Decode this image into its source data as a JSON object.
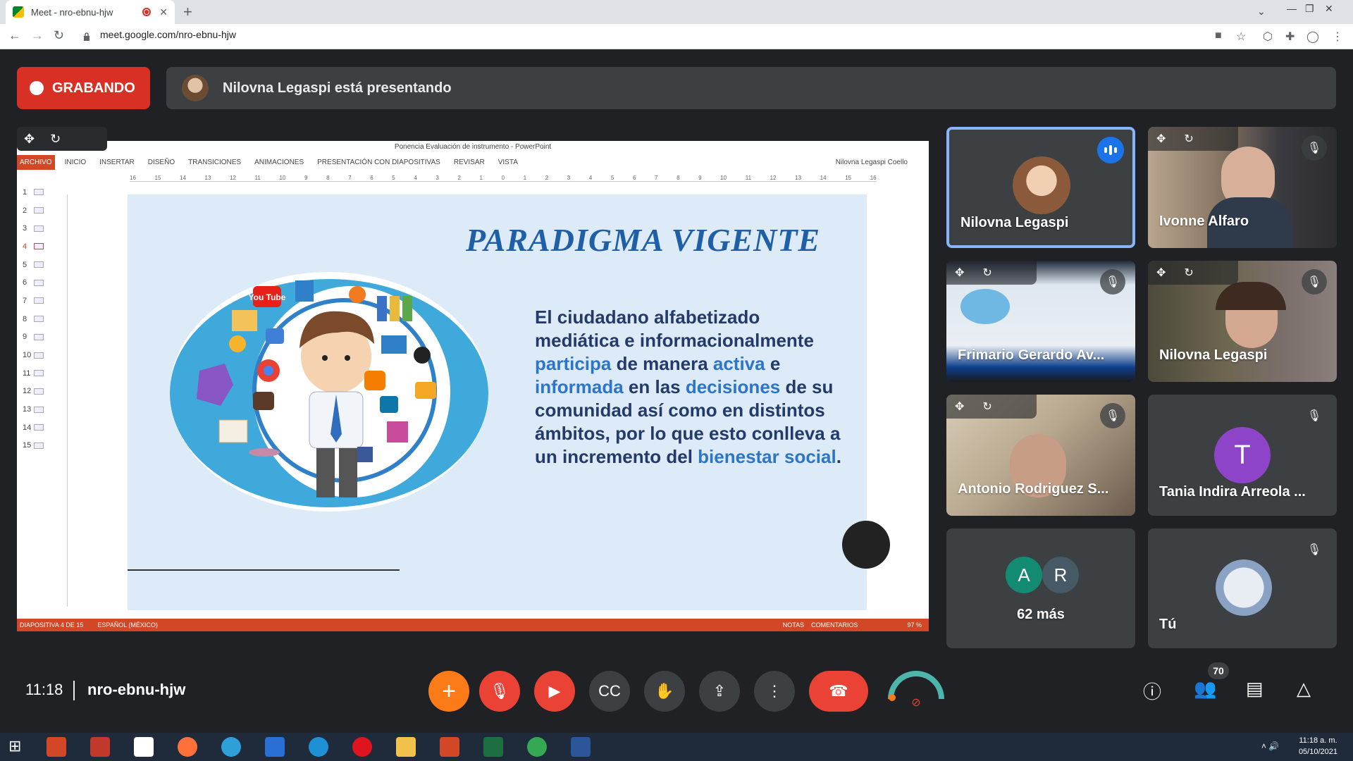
{
  "browser": {
    "tab_title": "Meet - nro-ebnu-hjw",
    "url": "meet.google.com/nro-ebnu-hjw"
  },
  "meet": {
    "recording_label": "GRABANDO",
    "presenter_text": "Nilovna Legaspi está presentando",
    "time": "11:18",
    "meeting_code": "nro-ebnu-hjw",
    "participant_count": "70"
  },
  "powerpoint": {
    "window_title": "Ponencia Evaluación de instrumento - PowerPoint",
    "ribbon_tabs": [
      "ARCHIVO",
      "INICIO",
      "INSERTAR",
      "DISEÑO",
      "TRANSICIONES",
      "ANIMACIONES",
      "PRESENTACIÓN CON DIAPOSITIVAS",
      "REVISAR",
      "VISTA"
    ],
    "user": "Nilovna Legaspi Coello",
    "thumbnails": [
      "1",
      "2",
      "3",
      "4",
      "5",
      "6",
      "7",
      "8",
      "9",
      "10",
      "11",
      "12",
      "13",
      "14",
      "15"
    ],
    "active_slide": "4",
    "status_slide": "DIAPOSITIVA 4 DE 15",
    "status_lang": "ESPAÑOL (MÉXICO)",
    "status_notes": "NOTAS",
    "status_comments": "COMENTARIOS",
    "zoom": "97 %",
    "ruler": [
      "16",
      "15",
      "14",
      "13",
      "12",
      "11",
      "10",
      "9",
      "8",
      "7",
      "6",
      "5",
      "4",
      "3",
      "2",
      "1",
      "0",
      "1",
      "2",
      "3",
      "4",
      "5",
      "6",
      "7",
      "8",
      "9",
      "10",
      "11",
      "12",
      "13",
      "14",
      "15",
      "16"
    ]
  },
  "slide": {
    "title": "PARADIGMA VIGENTE",
    "body_parts": [
      {
        "t": "El ciudadano alfabetizado mediática e informacionalmente ",
        "hl": false
      },
      {
        "t": "participa",
        "hl": true
      },
      {
        "t": " de manera ",
        "hl": false
      },
      {
        "t": "activa",
        "hl": true
      },
      {
        "t": " e ",
        "hl": false
      },
      {
        "t": "informada",
        "hl": true
      },
      {
        "t": " en las ",
        "hl": false
      },
      {
        "t": "decisiones",
        "hl": true
      },
      {
        "t": " de su comunidad así como en distintos ámbitos, por lo que esto conlleva a un incremento del ",
        "hl": false
      },
      {
        "t": "bienestar social",
        "hl": true
      },
      {
        "t": ".",
        "hl": false
      }
    ],
    "illustration_labels": {
      "youtube": "You Tube"
    }
  },
  "participants": [
    {
      "name": "Nilovna Legaspi",
      "state": "speaking"
    },
    {
      "name": "Ivonne Alfaro",
      "state": "muted"
    },
    {
      "name": "Frimario Gerardo Av...",
      "state": "muted"
    },
    {
      "name": "Nilovna Legaspi",
      "state": "muted"
    },
    {
      "name": "Antonio Rodriguez S...",
      "state": "muted"
    },
    {
      "name": "Tania Indira Arreola ...",
      "state": "muted",
      "initial": "T"
    },
    {
      "name": "62 más",
      "initials": [
        "A",
        "R"
      ]
    },
    {
      "name": "Tú",
      "state": "muted"
    }
  ],
  "colors": {
    "recording": "#d93025",
    "accent_blue": "#1a73e8",
    "tile_bg": "#3c4043",
    "ppt_orange": "#d24726"
  },
  "taskbar": {
    "time": "11:18 a. m.",
    "date": "05/10/2021"
  }
}
